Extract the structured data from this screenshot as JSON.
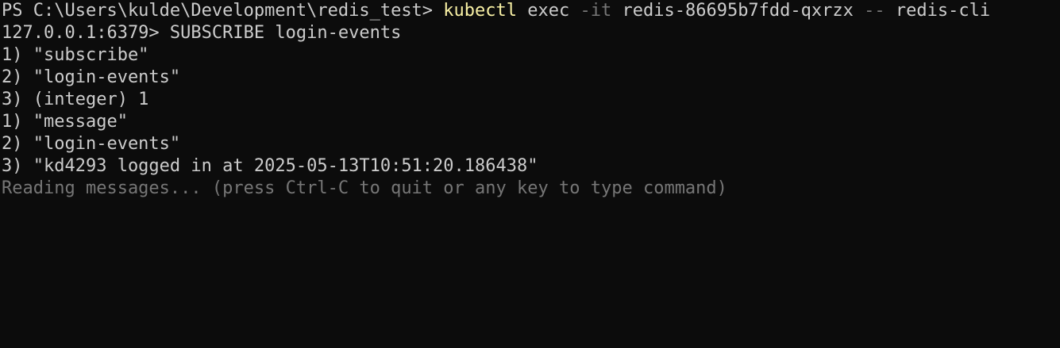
{
  "terminal": {
    "prompt": "PS C:\\Users\\kulde\\Development\\redis_test> ",
    "command": "kubectl",
    "args_1": " exec ",
    "flag_1": "-it",
    "args_2": " redis-86695b7fdd-qxrzx ",
    "flag_2": "--",
    "args_3": " redis-cli",
    "lines": [
      "127.0.0.1:6379> SUBSCRIBE login-events",
      "1) \"subscribe\"",
      "2) \"login-events\"",
      "3) (integer) 1",
      "1) \"message\"",
      "2) \"login-events\"",
      "3) \"kd4293 logged in at 2025-05-13T10:51:20.186438\""
    ],
    "status": "Reading messages... (press Ctrl-C to quit or any key to type command)"
  },
  "colors": {
    "background": "#0c0c0c",
    "text": "#cccccc",
    "command": "#f9f1a5",
    "dim": "#767676"
  }
}
